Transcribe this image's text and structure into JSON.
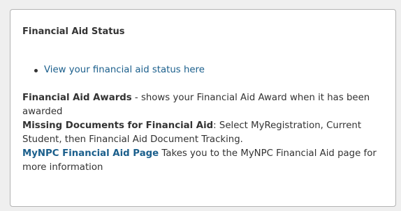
{
  "card": {
    "title": "Financial Aid Status",
    "status_link": "View your financial aid status here",
    "awards": {
      "label": "Financial Aid Awards",
      "text": " - shows your Financial Aid Award when it has been awarded"
    },
    "missing_docs": {
      "label": "Missing Documents for Financial Aid",
      "text": ": Select MyRegistration, Current Student, then Financial Aid Document Tracking."
    },
    "mynpc": {
      "link_label": "MyNPC Financial Aid Page",
      "text": " Takes you to the MyNPC Financial Aid page for more information"
    }
  },
  "colors": {
    "link": "#1b5f8c",
    "text": "#333333",
    "border": "#b3b3b3",
    "background": "#efefef"
  }
}
